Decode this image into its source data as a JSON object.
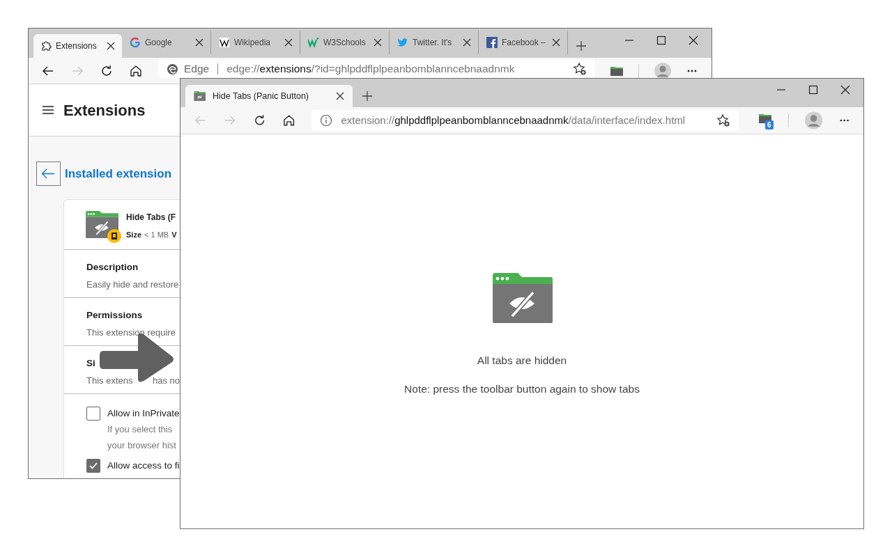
{
  "back_window": {
    "tabs": [
      {
        "kind": "puzzle",
        "label": "Extensions",
        "selected": true
      },
      {
        "kind": "google",
        "label": "Google",
        "selected": false
      },
      {
        "kind": "wiki",
        "label": "Wikipedia",
        "selected": false
      },
      {
        "kind": "w3",
        "label": "W3Schools",
        "selected": false
      },
      {
        "kind": "twitter",
        "label": "Twitter. It's",
        "selected": false
      },
      {
        "kind": "facebook",
        "label": "Facebook –",
        "selected": false
      }
    ],
    "address": {
      "site": "Edge",
      "prefix": "edge://",
      "host": "extensions",
      "rest": "/?id=ghlpddflplpeanbomblanncebnaadnmk"
    },
    "page": {
      "title": "Extensions",
      "back_link": "Installed extension",
      "extension": {
        "name": "Hide Tabs (F",
        "size_label": "Size",
        "size_value": "< 1 MB",
        "extra": "V"
      },
      "sections": [
        {
          "heading": "Description",
          "text": [
            "Easily hide and restore"
          ]
        },
        {
          "heading": "Permissions",
          "text": [
            "This extension require"
          ]
        },
        {
          "heading": "Si",
          "text": [
            "This extens",
            "has no"
          ]
        }
      ],
      "options": [
        {
          "label": "Allow in InPrivate",
          "checked": false,
          "description": [
            "If you select this",
            "your browser hist"
          ]
        },
        {
          "label": "Allow access to fi",
          "checked": true
        }
      ]
    }
  },
  "front_window": {
    "tabs": [
      {
        "label": "Hide Tabs (Panic Button)",
        "selected": true
      }
    ],
    "address": {
      "scheme": "extension://",
      "host": "ghlpddflplpeanbomblanncebnaadnmk",
      "path": "/data/interface/index.html"
    },
    "extension_badge": "6",
    "message": "All tabs are hidden",
    "note": "Note: press the toolbar button again to show tabs"
  }
}
